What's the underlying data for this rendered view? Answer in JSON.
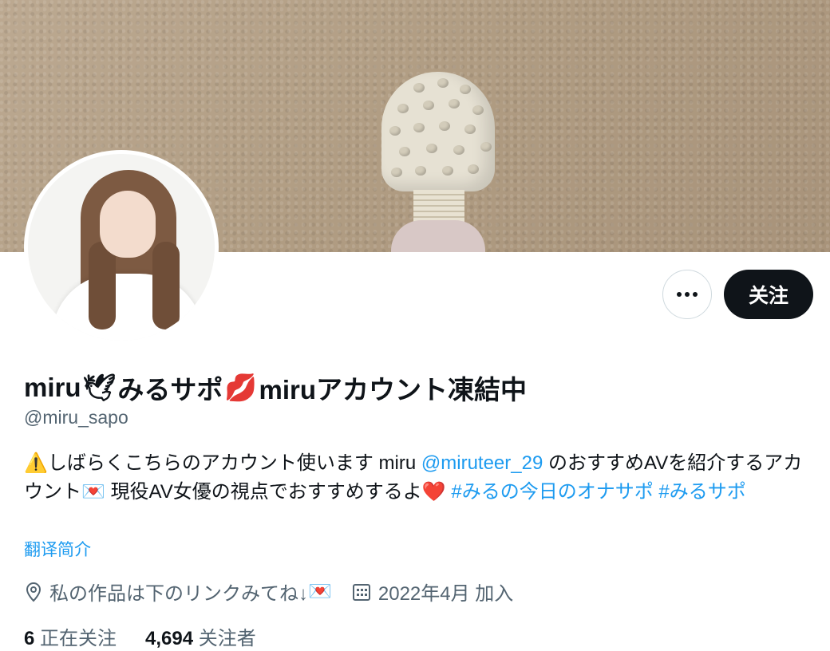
{
  "profile": {
    "name_prefix": "miru",
    "name_icon_1": "🕊",
    "name_middle": " みるサポ",
    "name_icon_2": "💋",
    "name_suffix": "miruアカウント凍結中",
    "handle": "@miru_sapo",
    "follow_label": "关注",
    "more_icon": "more-dots-icon"
  },
  "bio": {
    "warn_icon": "⚠️",
    "text_1": "しばらくこちらのアカウント使います miru ",
    "mention": "@miruteer_29",
    "text_2": " のおすすめAVを紹介するアカウント",
    "letter_icon": "💌",
    "text_3": " 現役AV女優の視点でおすすめするよ",
    "heart_icon": "❤️",
    "hashtag_1": " #みるの今日のオナサポ",
    "hashtag_2": " #みるサポ",
    "translate_label": "翻译简介"
  },
  "meta": {
    "location": "私の作品は下のリンクみてね↓",
    "location_icon_emoji": "💌",
    "joined": "2022年4月 加入"
  },
  "stats": {
    "following_count": "6",
    "following_label": " 正在关注",
    "followers_count": "4,694",
    "followers_label": " 关注者"
  },
  "colors": {
    "link": "#1d9bf0",
    "text": "#0f1419",
    "secondary": "#536471",
    "button_dark": "#0f1419"
  }
}
